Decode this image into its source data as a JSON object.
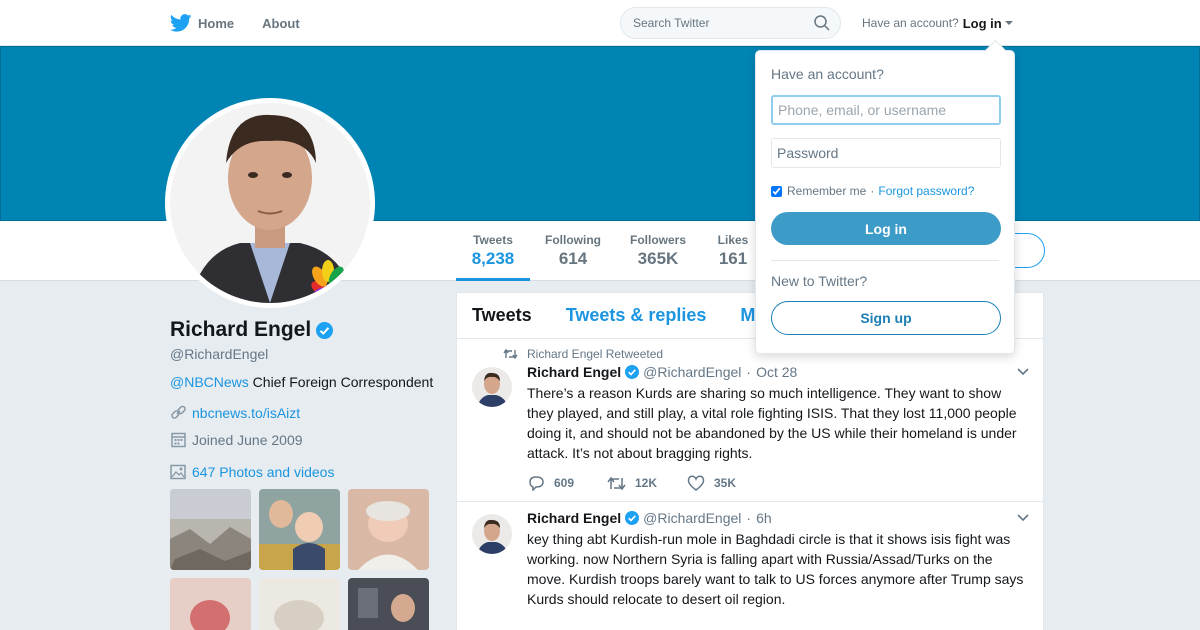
{
  "nav": {
    "home_label": "Home",
    "about_label": "About",
    "search_placeholder": "Search Twitter",
    "have_account": "Have an account?",
    "login_label": "Log in"
  },
  "profile": {
    "name": "Richard Engel",
    "handle": "@RichardEngel",
    "bio_mention": "@NBCNews",
    "bio_text": " Chief Foreign Correspondent",
    "link": "nbcnews.to/isAizt",
    "joined": "Joined June 2009",
    "photos_label": "647 Photos and videos"
  },
  "stats": [
    {
      "label": "Tweets",
      "value": "8,238"
    },
    {
      "label": "Following",
      "value": "614"
    },
    {
      "label": "Followers",
      "value": "365K"
    },
    {
      "label": "Likes",
      "value": "161"
    }
  ],
  "timeline": {
    "tabs": [
      "Tweets",
      "Tweets & replies",
      "M"
    ],
    "tweets": [
      {
        "retweet_label": "Richard Engel Retweeted",
        "name": "Richard Engel",
        "handle": "@RichardEngel",
        "time": "Oct 28",
        "text": "There’s a reason Kurds are sharing so much intelligence. They want to show they played, and still play, a vital role fighting ISIS. That they lost 11,000 people doing it, and should not be abandoned by the US while their homeland is under attack. It’s not about bragging rights.",
        "replies": "609",
        "retweets": "12K",
        "likes": "35K"
      },
      {
        "name": "Richard Engel",
        "handle": "@RichardEngel",
        "time": "6h",
        "text": "key thing abt Kurdish-run mole in Baghdadi circle is that it shows isis fight was working. now Northern Syria is falling apart with Russia/Assad/Turks on the move. Kurdish troops barely want to talk to US forces anymore after Trump says Kurds should relocate to desert oil region."
      }
    ]
  },
  "login_dropdown": {
    "heading": "Have an account?",
    "username_placeholder": "Phone, email, or username",
    "password_placeholder": "Password",
    "remember_label": "Remember me",
    "separator": "·",
    "forgot_label": "Forgot password?",
    "login_button": "Log in",
    "new_label": "New to Twitter?",
    "signup_button": "Sign up"
  },
  "colors": {
    "banner": "#0084b4",
    "link": "#1b95e0",
    "login_button": "#3d9bc7"
  }
}
